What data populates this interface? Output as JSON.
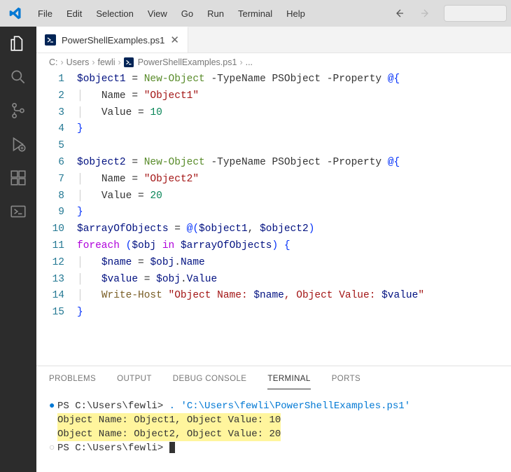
{
  "menu": [
    "File",
    "Edit",
    "Selection",
    "View",
    "Go",
    "Run",
    "Terminal",
    "Help"
  ],
  "tab": {
    "filename": "PowerShellExamples.ps1"
  },
  "breadcrumb": {
    "parts": [
      "C:",
      "Users",
      "fewli"
    ],
    "file": "PowerShellExamples.ps1",
    "trailing": "..."
  },
  "code": {
    "lines": [
      {
        "n": 1,
        "segs": [
          [
            "var",
            "$object1"
          ],
          [
            "op",
            " = "
          ],
          [
            "cmd",
            "New-Object"
          ],
          [
            "op",
            " -TypeName "
          ],
          [
            "param",
            "PSObject"
          ],
          [
            "op",
            " -Property "
          ],
          [
            "brace",
            "@{"
          ]
        ]
      },
      {
        "n": 2,
        "indent": 1,
        "segs": [
          [
            "param",
            "Name"
          ],
          [
            "op",
            " = "
          ],
          [
            "str",
            "\"Object1\""
          ]
        ]
      },
      {
        "n": 3,
        "indent": 1,
        "segs": [
          [
            "param",
            "Value"
          ],
          [
            "op",
            " = "
          ],
          [
            "num",
            "10"
          ]
        ]
      },
      {
        "n": 4,
        "segs": [
          [
            "brace",
            "}"
          ]
        ]
      },
      {
        "n": 5,
        "segs": []
      },
      {
        "n": 6,
        "segs": [
          [
            "var",
            "$object2"
          ],
          [
            "op",
            " = "
          ],
          [
            "cmd",
            "New-Object"
          ],
          [
            "op",
            " -TypeName "
          ],
          [
            "param",
            "PSObject"
          ],
          [
            "op",
            " -Property "
          ],
          [
            "brace",
            "@{"
          ]
        ]
      },
      {
        "n": 7,
        "indent": 1,
        "segs": [
          [
            "param",
            "Name"
          ],
          [
            "op",
            " = "
          ],
          [
            "str",
            "\"Object2\""
          ]
        ]
      },
      {
        "n": 8,
        "indent": 1,
        "segs": [
          [
            "param",
            "Value"
          ],
          [
            "op",
            " = "
          ],
          [
            "num",
            "20"
          ]
        ]
      },
      {
        "n": 9,
        "segs": [
          [
            "brace",
            "}"
          ]
        ]
      },
      {
        "n": 10,
        "segs": [
          [
            "var",
            "$arrayOfObjects"
          ],
          [
            "op",
            " = "
          ],
          [
            "brace",
            "@("
          ],
          [
            "var",
            "$object1"
          ],
          [
            "op",
            ", "
          ],
          [
            "var",
            "$object2"
          ],
          [
            "brace",
            ")"
          ]
        ]
      },
      {
        "n": 11,
        "segs": [
          [
            "kw",
            "foreach"
          ],
          [
            "op",
            " "
          ],
          [
            "brace",
            "("
          ],
          [
            "var",
            "$obj"
          ],
          [
            "op",
            " "
          ],
          [
            "kw",
            "in"
          ],
          [
            "op",
            " "
          ],
          [
            "var",
            "$arrayOfObjects"
          ],
          [
            "brace",
            ")"
          ],
          [
            "op",
            " "
          ],
          [
            "brace",
            "{"
          ]
        ]
      },
      {
        "n": 12,
        "indent": 1,
        "segs": [
          [
            "var",
            "$name"
          ],
          [
            "op",
            " = "
          ],
          [
            "var",
            "$obj"
          ],
          [
            "op",
            "."
          ],
          [
            "prop",
            "Name"
          ]
        ]
      },
      {
        "n": 13,
        "indent": 1,
        "segs": [
          [
            "var",
            "$value"
          ],
          [
            "op",
            " = "
          ],
          [
            "var",
            "$obj"
          ],
          [
            "op",
            "."
          ],
          [
            "prop",
            "Value"
          ]
        ]
      },
      {
        "n": 14,
        "indent": 1,
        "segs": [
          [
            "cmdlet",
            "Write-Host"
          ],
          [
            "op",
            " "
          ],
          [
            "str",
            "\"Object Name: "
          ],
          [
            "var",
            "$name"
          ],
          [
            "str",
            ", Object Value: "
          ],
          [
            "var",
            "$value"
          ],
          [
            "str",
            "\""
          ]
        ]
      },
      {
        "n": 15,
        "segs": [
          [
            "brace",
            "}"
          ]
        ]
      }
    ]
  },
  "panel": {
    "tabs": [
      "PROBLEMS",
      "OUTPUT",
      "DEBUG CONSOLE",
      "TERMINAL",
      "PORTS"
    ],
    "active": "TERMINAL"
  },
  "terminal": {
    "prompt1_path": "PS C:\\Users\\fewli>",
    "prompt1_cmd": ".",
    "prompt1_arg": "'C:\\Users\\fewli\\PowerShellExamples.ps1'",
    "out1": "Object Name: Object1, Object Value: 10",
    "out2": "Object Name: Object2, Object Value: 20",
    "prompt2_path": "PS C:\\Users\\fewli>"
  }
}
